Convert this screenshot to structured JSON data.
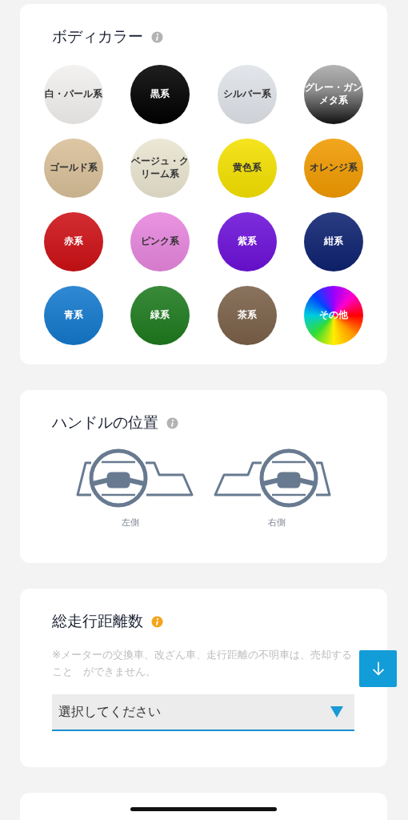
{
  "sections": [
    {
      "kind": "colors",
      "title": "ボディカラー",
      "info": {
        "kind": "neutral"
      },
      "colors": [
        {
          "label": "白・パール系",
          "color": "#f2f0ee",
          "kind": "solid"
        },
        {
          "label": "黒系",
          "color": "#000000",
          "kind": "solid"
        },
        {
          "label": "シルバー系",
          "color": "#dfe2e8",
          "kind": "solid"
        },
        {
          "label": "グレー・ガンメタ系",
          "color": "#8a8a8a",
          "kind": "metal"
        },
        {
          "label": "ゴールド系",
          "color": "#d8bf98",
          "kind": "solid"
        },
        {
          "label": "ベージュ・クリーム系",
          "color": "#e9e4d0",
          "kind": "solid"
        },
        {
          "label": "黄色系",
          "color": "#f3e000",
          "kind": "solid"
        },
        {
          "label": "オレンジ系",
          "color": "#f09a00",
          "kind": "solid"
        },
        {
          "label": "赤系",
          "color": "#cc1015",
          "kind": "solid"
        },
        {
          "label": "ピンク系",
          "color": "#e685dd",
          "kind": "solid"
        },
        {
          "label": "紫系",
          "color": "#6c10d8",
          "kind": "solid"
        },
        {
          "label": "紺系",
          "color": "#0d2270",
          "kind": "solid"
        },
        {
          "label": "青系",
          "color": "#1378cc",
          "kind": "solid"
        },
        {
          "label": "緑系",
          "color": "#1e7a1e",
          "kind": "solid"
        },
        {
          "label": "茶系",
          "color": "#7a6048",
          "kind": "solid"
        },
        {
          "label": "その他",
          "kind": "rainbow"
        }
      ]
    },
    {
      "kind": "steering",
      "title": "ハンドルの位置",
      "info": {
        "kind": "neutral"
      },
      "options": [
        {
          "label": "左側",
          "kind": "left"
        },
        {
          "label": "右側",
          "kind": "right"
        }
      ]
    },
    {
      "kind": "mileage",
      "title": "総走行距離数",
      "info": {
        "kind": "warning"
      },
      "note": "※メーターの交換車、改ざん車、走行距離の不明車は、売却すること　ができません。",
      "dropdown": {
        "value": "選択してください"
      }
    },
    {
      "kind": "partial"
    }
  ]
}
